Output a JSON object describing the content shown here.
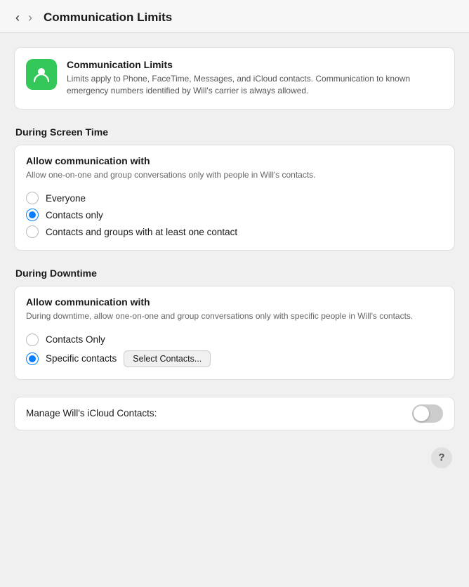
{
  "header": {
    "title": "Communication Limits",
    "back_label": "‹",
    "forward_label": "›"
  },
  "app_card": {
    "title": "Communication Limits",
    "description": "Limits apply to Phone, FaceTime, Messages, and iCloud contacts. Communication to known emergency numbers identified by Will's carrier is always allowed.",
    "icon_alt": "communication-limits-icon"
  },
  "screen_time_section": {
    "label": "During Screen Time",
    "panel_title": "Allow communication with",
    "panel_desc": "Allow one-on-one and group conversations only with people in Will's contacts.",
    "options": [
      {
        "id": "st_everyone",
        "label": "Everyone",
        "checked": false
      },
      {
        "id": "st_contacts_only",
        "label": "Contacts only",
        "checked": true
      },
      {
        "id": "st_contacts_groups",
        "label": "Contacts and groups with at least one contact",
        "checked": false
      }
    ]
  },
  "downtime_section": {
    "label": "During Downtime",
    "panel_title": "Allow communication with",
    "panel_desc": "During downtime, allow one-on-one and group conversations only with specific people in Will's contacts.",
    "options": [
      {
        "id": "dt_contacts_only",
        "label": "Contacts Only",
        "checked": false
      },
      {
        "id": "dt_specific_contacts",
        "label": "Specific contacts",
        "checked": true
      }
    ],
    "select_contacts_btn": "Select Contacts..."
  },
  "manage_row": {
    "label": "Manage Will's iCloud Contacts:",
    "toggle_on": false
  },
  "help_btn": "?"
}
